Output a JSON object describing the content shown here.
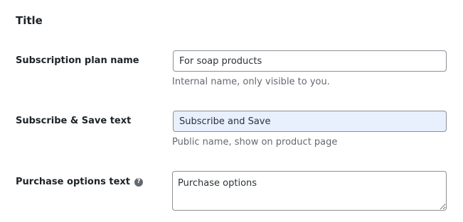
{
  "section": {
    "title": "Title"
  },
  "fields": {
    "plan_name": {
      "label": "Subscription plan name",
      "value": "For soap products",
      "hint": "Internal name, only visible to you."
    },
    "subscribe_save": {
      "label": "Subscribe & Save text",
      "value": "Subscribe and Save",
      "hint": "Public name, show on product page"
    },
    "purchase_options": {
      "label": "Purchase options text",
      "help_icon": "question-mark",
      "value": "Purchase options"
    }
  }
}
